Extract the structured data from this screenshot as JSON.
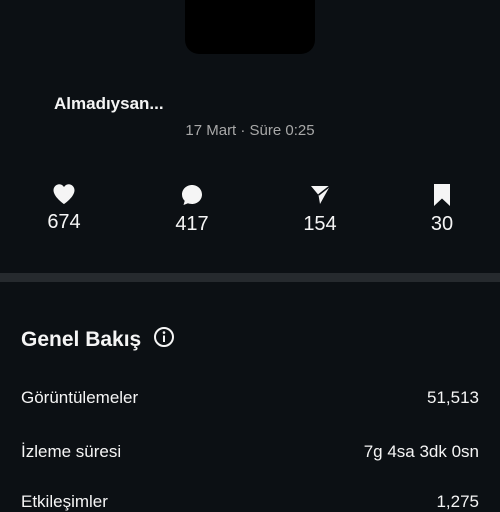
{
  "post": {
    "caption": "Almadıysan...",
    "meta": "17 Mart · Süre 0:25"
  },
  "stats": [
    {
      "icon": "heart-icon",
      "value": "674"
    },
    {
      "icon": "comment-icon",
      "value": "417"
    },
    {
      "icon": "share-icon",
      "value": "154"
    },
    {
      "icon": "bookmark-icon",
      "value": "30"
    }
  ],
  "overview": {
    "title": "Genel Bakış",
    "rows": [
      {
        "label": "Görüntülemeler",
        "value": "51,513"
      },
      {
        "label": "İzleme süresi",
        "value": "7g 4sa 3dk 0sn"
      },
      {
        "label": "Etkileşimler",
        "value": "1,275"
      }
    ]
  }
}
